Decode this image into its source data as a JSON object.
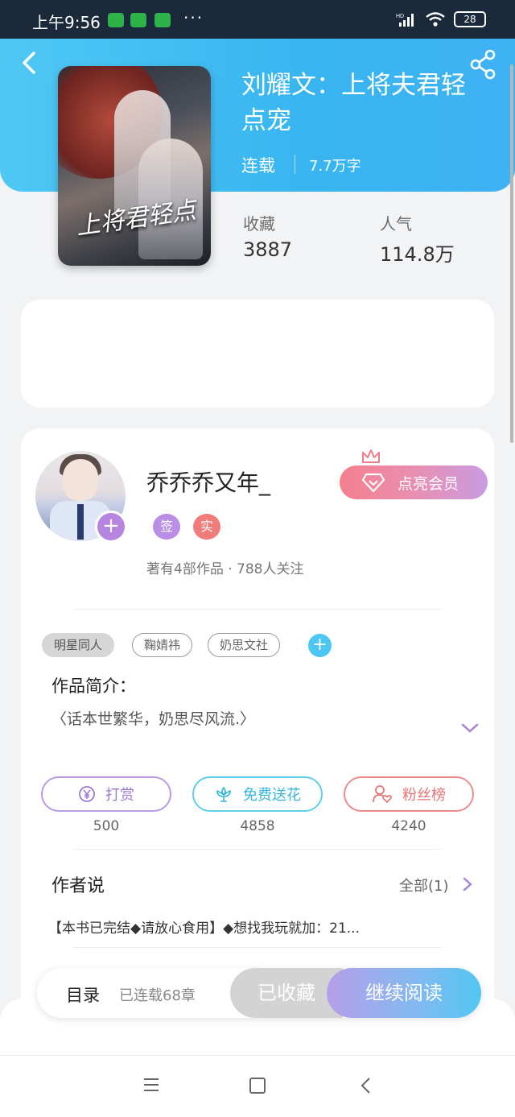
{
  "status_bar": {
    "time": "上午9:56",
    "dots": "···",
    "battery": "28",
    "network_label": "HD"
  },
  "book": {
    "title": "刘耀文：上将夫君轻点宠",
    "status": "连载",
    "word_count": "7.7万字",
    "cover_text": "上将君轻点",
    "stats": [
      {
        "label": "收藏",
        "value": "3887"
      },
      {
        "label": "人气",
        "value": "114.8万"
      }
    ]
  },
  "author": {
    "name": "乔乔乔又年_",
    "badges": [
      "签",
      "实"
    ],
    "meta": "著有4部作品 · 788人关注",
    "vip_button": "点亮会员",
    "add_badge": "+"
  },
  "tags": [
    "明星同人",
    "鞠婧祎",
    "奶思文社"
  ],
  "tag_add": "+",
  "intro": {
    "title": "作品简介：",
    "text": "〈话本世繁华，奶思尽风流.〉"
  },
  "actions": [
    {
      "label": "打赏",
      "count": "500",
      "icon": "yen-coin-icon"
    },
    {
      "label": "免费送花",
      "count": "4858",
      "icon": "flower-icon"
    },
    {
      "label": "粉丝榜",
      "count": "4240",
      "icon": "fans-heart-icon"
    }
  ],
  "author_says": {
    "title": "作者说",
    "all_label": "全部(1)",
    "text": "【本书已完结◆请放心食用】◆想找我玩就加：21..."
  },
  "bottom": {
    "toc_label": "目录",
    "chapter_count": "已连载68章",
    "collected_label": "已收藏",
    "read_label": "继续阅读"
  },
  "colors": {
    "header_gradient_start": "#4fc8f5",
    "header_gradient_end": "#3fb2f2",
    "accent_purple": "#b685e0",
    "accent_cyan": "#4cc6f3",
    "accent_red": "#ef7b7b"
  }
}
